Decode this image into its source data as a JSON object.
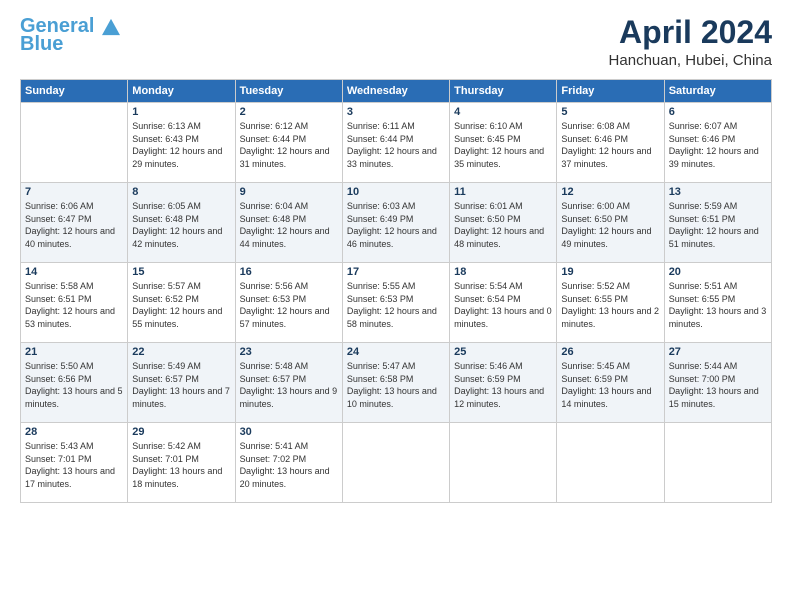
{
  "header": {
    "logo_line1": "General",
    "logo_line2": "Blue",
    "month": "April 2024",
    "location": "Hanchuan, Hubei, China"
  },
  "days_of_week": [
    "Sunday",
    "Monday",
    "Tuesday",
    "Wednesday",
    "Thursday",
    "Friday",
    "Saturday"
  ],
  "weeks": [
    [
      {
        "day": "",
        "sunrise": "",
        "sunset": "",
        "daylight": ""
      },
      {
        "day": "1",
        "sunrise": "Sunrise: 6:13 AM",
        "sunset": "Sunset: 6:43 PM",
        "daylight": "Daylight: 12 hours and 29 minutes."
      },
      {
        "day": "2",
        "sunrise": "Sunrise: 6:12 AM",
        "sunset": "Sunset: 6:44 PM",
        "daylight": "Daylight: 12 hours and 31 minutes."
      },
      {
        "day": "3",
        "sunrise": "Sunrise: 6:11 AM",
        "sunset": "Sunset: 6:44 PM",
        "daylight": "Daylight: 12 hours and 33 minutes."
      },
      {
        "day": "4",
        "sunrise": "Sunrise: 6:10 AM",
        "sunset": "Sunset: 6:45 PM",
        "daylight": "Daylight: 12 hours and 35 minutes."
      },
      {
        "day": "5",
        "sunrise": "Sunrise: 6:08 AM",
        "sunset": "Sunset: 6:46 PM",
        "daylight": "Daylight: 12 hours and 37 minutes."
      },
      {
        "day": "6",
        "sunrise": "Sunrise: 6:07 AM",
        "sunset": "Sunset: 6:46 PM",
        "daylight": "Daylight: 12 hours and 39 minutes."
      }
    ],
    [
      {
        "day": "7",
        "sunrise": "Sunrise: 6:06 AM",
        "sunset": "Sunset: 6:47 PM",
        "daylight": "Daylight: 12 hours and 40 minutes."
      },
      {
        "day": "8",
        "sunrise": "Sunrise: 6:05 AM",
        "sunset": "Sunset: 6:48 PM",
        "daylight": "Daylight: 12 hours and 42 minutes."
      },
      {
        "day": "9",
        "sunrise": "Sunrise: 6:04 AM",
        "sunset": "Sunset: 6:48 PM",
        "daylight": "Daylight: 12 hours and 44 minutes."
      },
      {
        "day": "10",
        "sunrise": "Sunrise: 6:03 AM",
        "sunset": "Sunset: 6:49 PM",
        "daylight": "Daylight: 12 hours and 46 minutes."
      },
      {
        "day": "11",
        "sunrise": "Sunrise: 6:01 AM",
        "sunset": "Sunset: 6:50 PM",
        "daylight": "Daylight: 12 hours and 48 minutes."
      },
      {
        "day": "12",
        "sunrise": "Sunrise: 6:00 AM",
        "sunset": "Sunset: 6:50 PM",
        "daylight": "Daylight: 12 hours and 49 minutes."
      },
      {
        "day": "13",
        "sunrise": "Sunrise: 5:59 AM",
        "sunset": "Sunset: 6:51 PM",
        "daylight": "Daylight: 12 hours and 51 minutes."
      }
    ],
    [
      {
        "day": "14",
        "sunrise": "Sunrise: 5:58 AM",
        "sunset": "Sunset: 6:51 PM",
        "daylight": "Daylight: 12 hours and 53 minutes."
      },
      {
        "day": "15",
        "sunrise": "Sunrise: 5:57 AM",
        "sunset": "Sunset: 6:52 PM",
        "daylight": "Daylight: 12 hours and 55 minutes."
      },
      {
        "day": "16",
        "sunrise": "Sunrise: 5:56 AM",
        "sunset": "Sunset: 6:53 PM",
        "daylight": "Daylight: 12 hours and 57 minutes."
      },
      {
        "day": "17",
        "sunrise": "Sunrise: 5:55 AM",
        "sunset": "Sunset: 6:53 PM",
        "daylight": "Daylight: 12 hours and 58 minutes."
      },
      {
        "day": "18",
        "sunrise": "Sunrise: 5:54 AM",
        "sunset": "Sunset: 6:54 PM",
        "daylight": "Daylight: 13 hours and 0 minutes."
      },
      {
        "day": "19",
        "sunrise": "Sunrise: 5:52 AM",
        "sunset": "Sunset: 6:55 PM",
        "daylight": "Daylight: 13 hours and 2 minutes."
      },
      {
        "day": "20",
        "sunrise": "Sunrise: 5:51 AM",
        "sunset": "Sunset: 6:55 PM",
        "daylight": "Daylight: 13 hours and 3 minutes."
      }
    ],
    [
      {
        "day": "21",
        "sunrise": "Sunrise: 5:50 AM",
        "sunset": "Sunset: 6:56 PM",
        "daylight": "Daylight: 13 hours and 5 minutes."
      },
      {
        "day": "22",
        "sunrise": "Sunrise: 5:49 AM",
        "sunset": "Sunset: 6:57 PM",
        "daylight": "Daylight: 13 hours and 7 minutes."
      },
      {
        "day": "23",
        "sunrise": "Sunrise: 5:48 AM",
        "sunset": "Sunset: 6:57 PM",
        "daylight": "Daylight: 13 hours and 9 minutes."
      },
      {
        "day": "24",
        "sunrise": "Sunrise: 5:47 AM",
        "sunset": "Sunset: 6:58 PM",
        "daylight": "Daylight: 13 hours and 10 minutes."
      },
      {
        "day": "25",
        "sunrise": "Sunrise: 5:46 AM",
        "sunset": "Sunset: 6:59 PM",
        "daylight": "Daylight: 13 hours and 12 minutes."
      },
      {
        "day": "26",
        "sunrise": "Sunrise: 5:45 AM",
        "sunset": "Sunset: 6:59 PM",
        "daylight": "Daylight: 13 hours and 14 minutes."
      },
      {
        "day": "27",
        "sunrise": "Sunrise: 5:44 AM",
        "sunset": "Sunset: 7:00 PM",
        "daylight": "Daylight: 13 hours and 15 minutes."
      }
    ],
    [
      {
        "day": "28",
        "sunrise": "Sunrise: 5:43 AM",
        "sunset": "Sunset: 7:01 PM",
        "daylight": "Daylight: 13 hours and 17 minutes."
      },
      {
        "day": "29",
        "sunrise": "Sunrise: 5:42 AM",
        "sunset": "Sunset: 7:01 PM",
        "daylight": "Daylight: 13 hours and 18 minutes."
      },
      {
        "day": "30",
        "sunrise": "Sunrise: 5:41 AM",
        "sunset": "Sunset: 7:02 PM",
        "daylight": "Daylight: 13 hours and 20 minutes."
      },
      {
        "day": "",
        "sunrise": "",
        "sunset": "",
        "daylight": ""
      },
      {
        "day": "",
        "sunrise": "",
        "sunset": "",
        "daylight": ""
      },
      {
        "day": "",
        "sunrise": "",
        "sunset": "",
        "daylight": ""
      },
      {
        "day": "",
        "sunrise": "",
        "sunset": "",
        "daylight": ""
      }
    ]
  ]
}
